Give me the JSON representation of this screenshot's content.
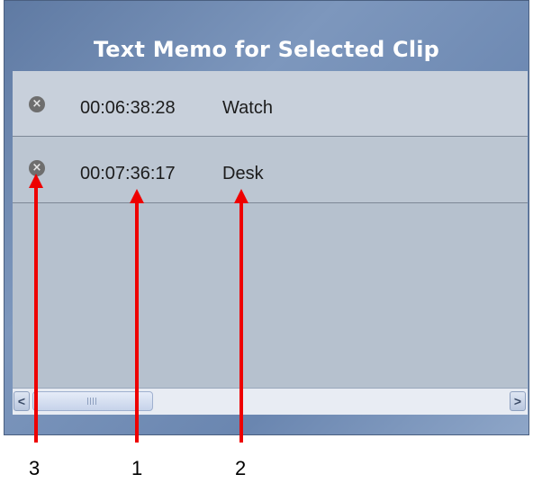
{
  "panel": {
    "title": "Text Memo for Selected Clip"
  },
  "memos": [
    {
      "timecode": "00:06:38:28",
      "text": "Watch",
      "delete_glyph": "×"
    },
    {
      "timecode": "00:07:36:17",
      "text": "Desk",
      "delete_glyph": "×"
    }
  ],
  "scrollbar": {
    "left_arrow": "<",
    "right_arrow": ">"
  },
  "callouts": {
    "label_1": "1",
    "label_2": "2",
    "label_3": "3",
    "color": "#ee0000"
  }
}
